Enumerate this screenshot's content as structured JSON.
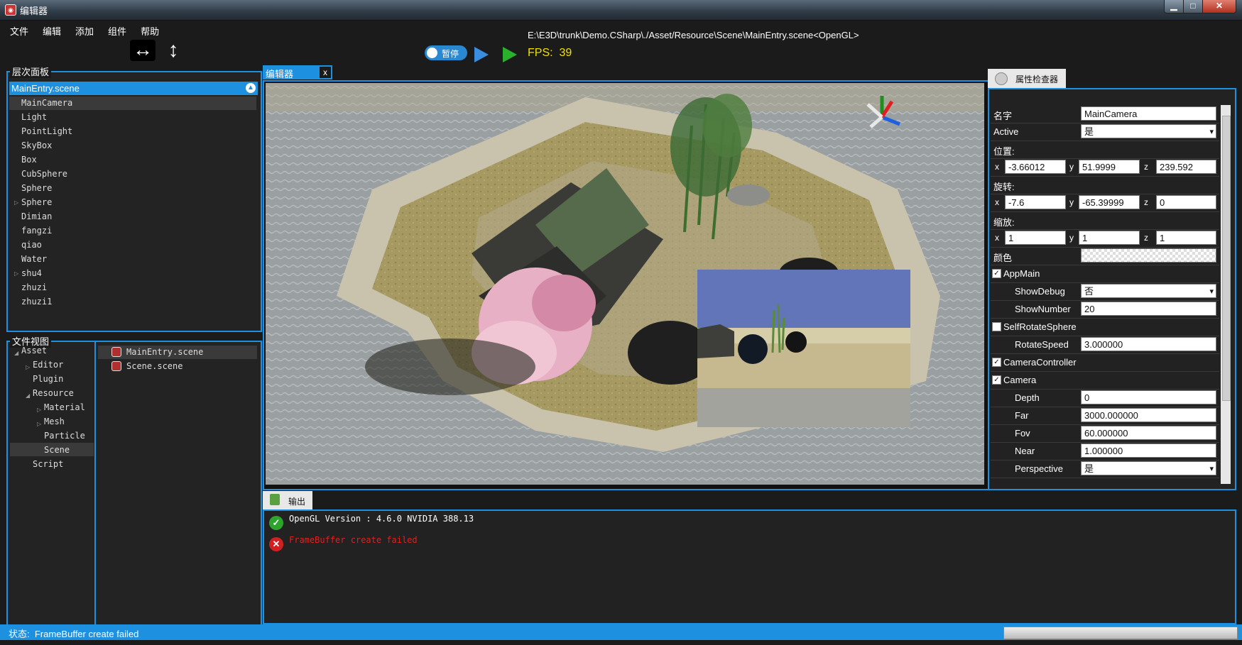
{
  "window": {
    "title": "编辑器",
    "minimize_icon": "minimize-icon",
    "maximize_icon": "maximize-icon",
    "close_icon": "close-icon"
  },
  "menu": [
    "文件",
    "编辑",
    "添加",
    "组件",
    "帮助"
  ],
  "toolbar": {
    "path": "E:\\E3D\\trunk\\Demo.CSharp\\./Asset/Resource\\Scene\\MainEntry.scene<OpenGL>",
    "pause_label": "暂停",
    "fps_label": "FPS:",
    "fps_value": "39"
  },
  "hierarchy": {
    "title": "层次面板",
    "root": "MainEntry.scene",
    "items": [
      "MainCamera",
      "Light",
      "PointLight",
      "SkyBox",
      "Box",
      "CubSphere",
      "Sphere",
      "Sphere",
      "Dimian",
      "fangzi",
      "qiao",
      "Water",
      "shu4",
      "zhuzi",
      "zhuzi1"
    ]
  },
  "files": {
    "title": "文件视图",
    "tree": [
      "Asset",
      "Editor",
      "Plugin",
      "Resource",
      "Material",
      "Mesh",
      "Particle",
      "Scene",
      "Script"
    ],
    "list": [
      "MainEntry.scene",
      "Scene.scene"
    ]
  },
  "editor": {
    "tab_label": "编辑器",
    "close_label": "x"
  },
  "inspector": {
    "tab_label": "属性检查器",
    "name_label": "名字",
    "name_value": "MainCamera",
    "active_label": "Active",
    "active_value": "是",
    "position_label": "位置:",
    "pos_x": "-3.66012",
    "pos_y": "51.9999",
    "pos_z": "239.592",
    "rotation_label": "旋转:",
    "rot_x": "-7.6",
    "rot_y": "-65.39999",
    "rot_z": "0",
    "scale_label": "缩放:",
    "scale_x": "1",
    "scale_y": "1",
    "scale_z": "1",
    "color_label": "颜色",
    "axis_x": "x",
    "axis_y": "y",
    "axis_z": "z",
    "appmain_label": "AppMain",
    "appmain_checked": true,
    "showdebug_label": "ShowDebug",
    "showdebug_value": "否",
    "shownumber_label": "ShowNumber",
    "shownumber_value": "20",
    "selfrotate_label": "SelfRotateSphere",
    "selfrotate_checked": false,
    "rotatespeed_label": "RotateSpeed",
    "rotatespeed_value": "3.000000",
    "camctrl_label": "CameraController",
    "camctrl_checked": true,
    "camera_label": "Camera",
    "camera_checked": true,
    "depth_label": "Depth",
    "depth_value": "0",
    "far_label": "Far",
    "far_value": "3000.000000",
    "fov_label": "Fov",
    "fov_value": "60.000000",
    "near_label": "Near",
    "near_value": "1.000000",
    "perspective_label": "Perspective",
    "perspective_value": "是"
  },
  "output": {
    "tab_label": "输出",
    "logs": [
      {
        "type": "ok",
        "text": "OpenGL Version : 4.6.0 NVIDIA 388.13",
        "color": "#ffffff"
      },
      {
        "type": "error",
        "text": "FrameBuffer create failed",
        "color": "#e02020"
      }
    ]
  },
  "status": {
    "label": "状态:",
    "text": "FrameBuffer create failed"
  },
  "colors": {
    "accent": "#1e90e0",
    "fps": "#f0e000",
    "error": "#e02020"
  }
}
